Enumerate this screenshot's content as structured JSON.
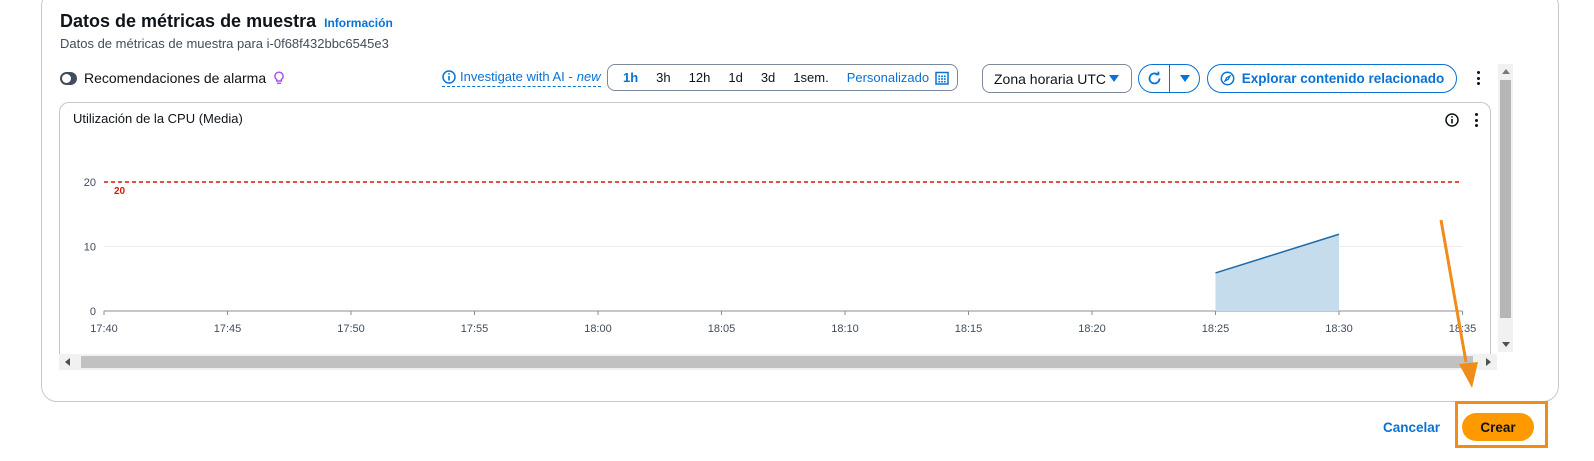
{
  "header": {
    "title": "Datos de métricas de muestra",
    "info_link": "Información",
    "subtitle": "Datos de métricas de muestra para i-0f68f432bbc6545e3"
  },
  "toolbar": {
    "alarm_recommendations_label": "Recomendaciones de alarma",
    "alarm_recommendations_enabled": false,
    "ai_link_text": "Investigate with AI - ",
    "ai_link_badge": "new",
    "time_ranges": [
      "1h",
      "3h",
      "12h",
      "1d",
      "3d",
      "1sem."
    ],
    "selected_time_range": "1h",
    "custom_range_label": "Personalizado",
    "timezone_label": "Zona horaria UTC",
    "explore_label": "Explorar contenido relacionado"
  },
  "chart": {
    "title": "Utilización de la CPU (Media)"
  },
  "chart_data": {
    "type": "area",
    "title": "Utilización de la CPU (Media)",
    "xlabel": "",
    "ylabel": "",
    "x_ticks": [
      "17:40",
      "17:45",
      "17:50",
      "17:55",
      "18:00",
      "18:05",
      "18:10",
      "18:15",
      "18:20",
      "18:25",
      "18:30",
      "18:35"
    ],
    "y_ticks": [
      0,
      10,
      20
    ],
    "ylim": [
      0,
      20
    ],
    "series": [
      {
        "x": [
          "18:25",
          "18:30"
        ],
        "values": [
          5.9,
          11.9
        ]
      }
    ],
    "threshold": {
      "value": 20,
      "label": "20",
      "style": "dashed"
    },
    "colors": {
      "area_fill": "#c5dcec",
      "line": "#1f6aa5",
      "threshold": "#d91515"
    },
    "grid": true
  },
  "actions": {
    "cancel_label": "Cancelar",
    "create_label": "Crear"
  },
  "colors": {
    "link_blue": "#0972d3",
    "primary_orange": "#ff9900",
    "annotation_orange": "#f08c1a"
  }
}
